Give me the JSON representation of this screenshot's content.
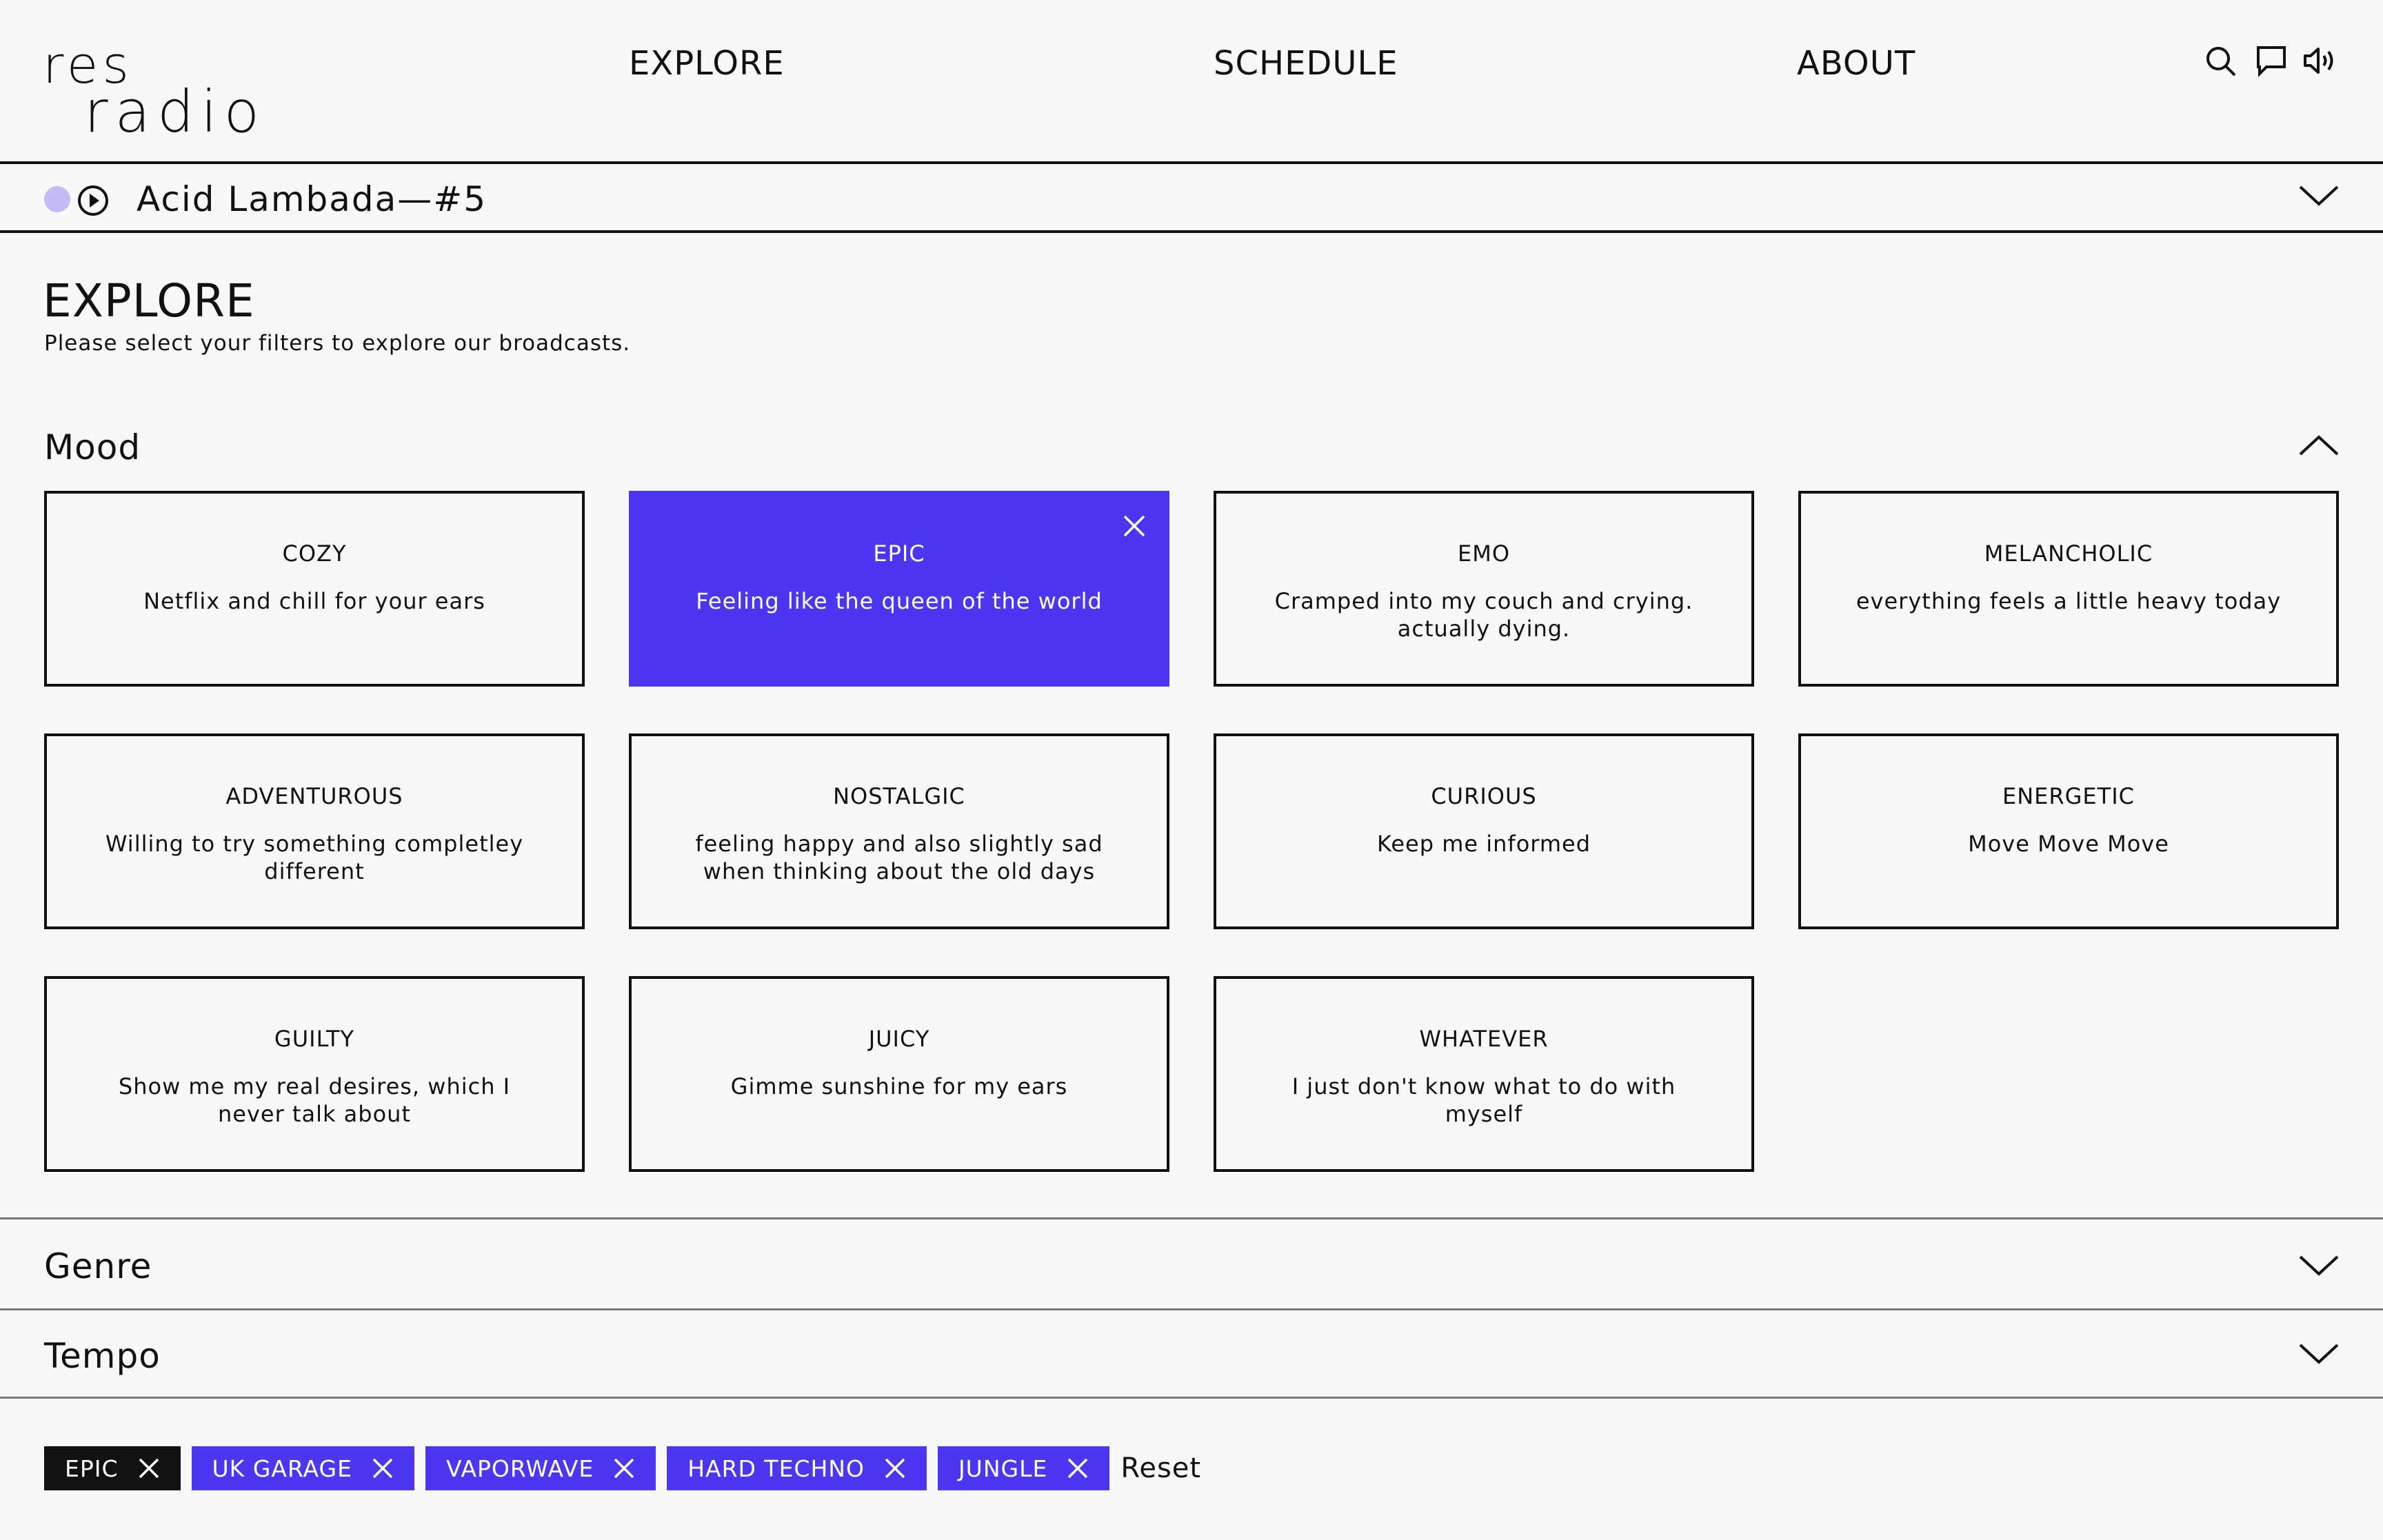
{
  "header": {
    "logo_top": "res",
    "logo_bottom": "radio",
    "nav": [
      "EXPLORE",
      "SCHEDULE",
      "ABOUT"
    ],
    "icons": [
      "search-icon",
      "chat-icon",
      "volume-icon"
    ]
  },
  "player": {
    "track": "Acid Lambada—#5",
    "live_dot_color": "#c4bcf4"
  },
  "explore": {
    "title": "EXPLORE",
    "subtitle": "Please select your filters to explore our broadcasts."
  },
  "sections": {
    "mood": "Mood",
    "genre": "Genre",
    "tempo": "Tempo"
  },
  "moods": [
    {
      "name": "COZY",
      "desc": "Netflix and chill for your ears",
      "selected": false
    },
    {
      "name": "EPIC",
      "desc": "Feeling like the queen of the world",
      "selected": true
    },
    {
      "name": "EMO",
      "desc": "Cramped into my couch and crying. actually dying.",
      "selected": false
    },
    {
      "name": "MELANCHOLIC",
      "desc": "everything feels a little heavy today",
      "selected": false
    },
    {
      "name": "ADVENTUROUS",
      "desc": "Willing to try something completley different",
      "selected": false
    },
    {
      "name": "NOSTALGIC",
      "desc": "feeling happy and also slightly sad when thinking about the old days",
      "selected": false
    },
    {
      "name": "CURIOUS",
      "desc": "Keep me informed",
      "selected": false
    },
    {
      "name": "ENERGETIC",
      "desc": "Move Move Move",
      "selected": false
    },
    {
      "name": "GUILTY",
      "desc": "Show me my real desires, which I never talk about",
      "selected": false
    },
    {
      "name": "JUICY",
      "desc": "Gimme sunshine for my ears",
      "selected": false
    },
    {
      "name": "WHATEVER",
      "desc": "I just don't know what to do with myself",
      "selected": false
    }
  ],
  "filters": {
    "chips": [
      "EPIC",
      "UK GARAGE",
      "VAPORWAVE",
      "HARD TECHNO",
      "JUNGLE"
    ],
    "reset": "Reset"
  },
  "colors": {
    "accent": "#4a37ef",
    "text": "#111111",
    "background": "#f8f8f8"
  }
}
